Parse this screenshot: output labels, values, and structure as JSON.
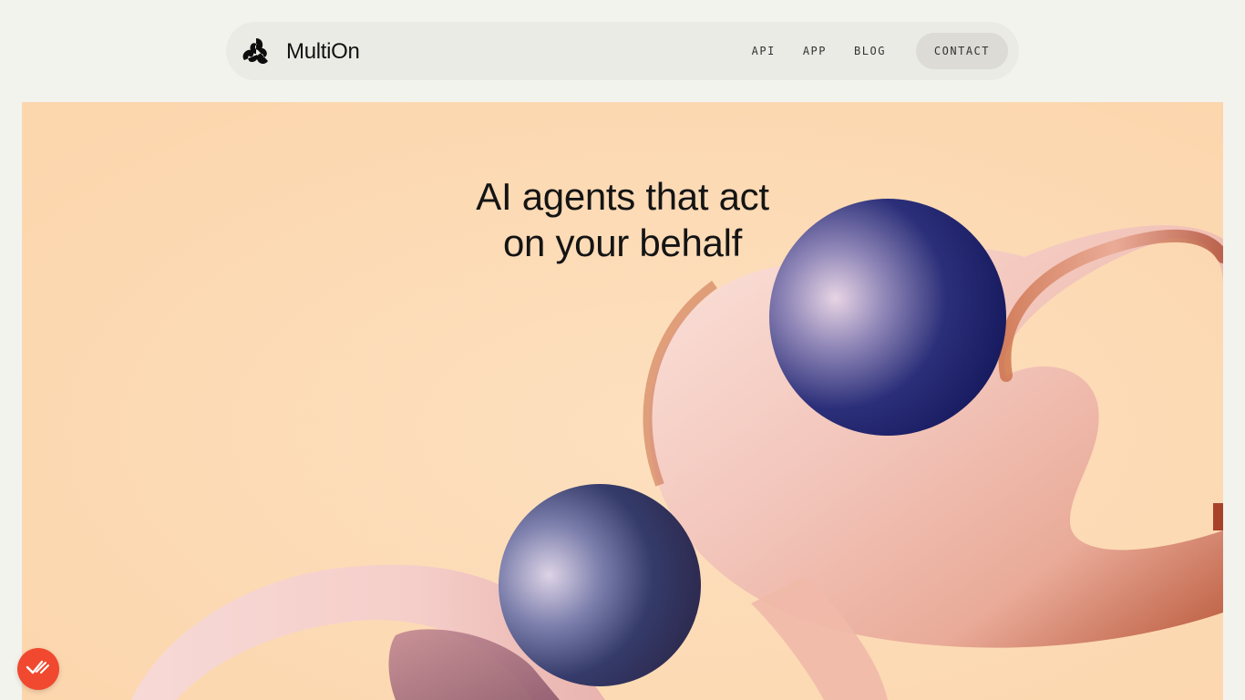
{
  "brand": {
    "name": "MultiOn",
    "logo_icon": "multion-triskelion-icon"
  },
  "nav": {
    "items": [
      {
        "label": "API"
      },
      {
        "label": "APP"
      },
      {
        "label": "BLOG"
      }
    ],
    "contact_label": "CONTACT"
  },
  "hero": {
    "title_line1": "AI agents that act",
    "title_line2": "on your behalf",
    "background": "#fddbb3"
  },
  "badge": {
    "icon": "double-check-icon",
    "color": "#f0492f"
  },
  "colors": {
    "page_bg": "#f3f3ee",
    "navbar_bg": "#ebebe6",
    "contact_bg": "#dcdbd5",
    "sphere_navy": "#1b1f5e",
    "ribbon_pink": "#f4c6bc",
    "ribbon_rust": "#b5532b"
  }
}
